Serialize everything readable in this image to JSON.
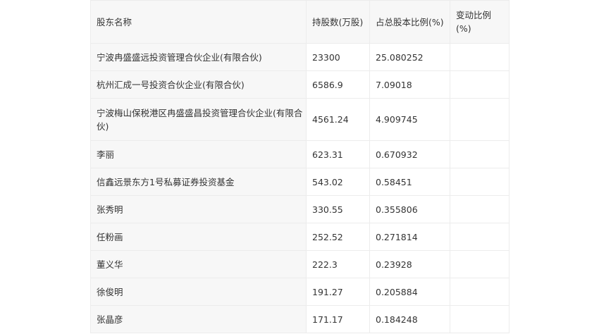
{
  "headers": [
    "股东名称",
    "持股数(万股)",
    "占总股本比例(%)",
    "变动比例(%)"
  ],
  "rows": [
    {
      "name": "宁波冉盛盛远投资管理合伙企业(有限合伙)",
      "shares": "23300",
      "ratio": "25.080252",
      "change": ""
    },
    {
      "name": "杭州汇成一号投资合伙企业(有限合伙)",
      "shares": "6586.9",
      "ratio": "7.09018",
      "change": ""
    },
    {
      "name": "宁波梅山保税港区冉盛盛昌投资管理合伙企业(有限合伙)",
      "shares": "4561.24",
      "ratio": "4.909745",
      "change": ""
    },
    {
      "name": "李丽",
      "shares": "623.31",
      "ratio": "0.670932",
      "change": ""
    },
    {
      "name": "信鑫远景东方1号私募证券投资基金",
      "shares": "543.02",
      "ratio": "0.58451",
      "change": ""
    },
    {
      "name": "张秀明",
      "shares": "330.55",
      "ratio": "0.355806",
      "change": ""
    },
    {
      "name": "任粉画",
      "shares": "252.52",
      "ratio": "0.271814",
      "change": ""
    },
    {
      "name": "董义华",
      "shares": "222.3",
      "ratio": "0.23928",
      "change": ""
    },
    {
      "name": "徐俊明",
      "shares": "191.27",
      "ratio": "0.205884",
      "change": ""
    },
    {
      "name": "张晶彦",
      "shares": "171.17",
      "ratio": "0.184248",
      "change": ""
    }
  ]
}
